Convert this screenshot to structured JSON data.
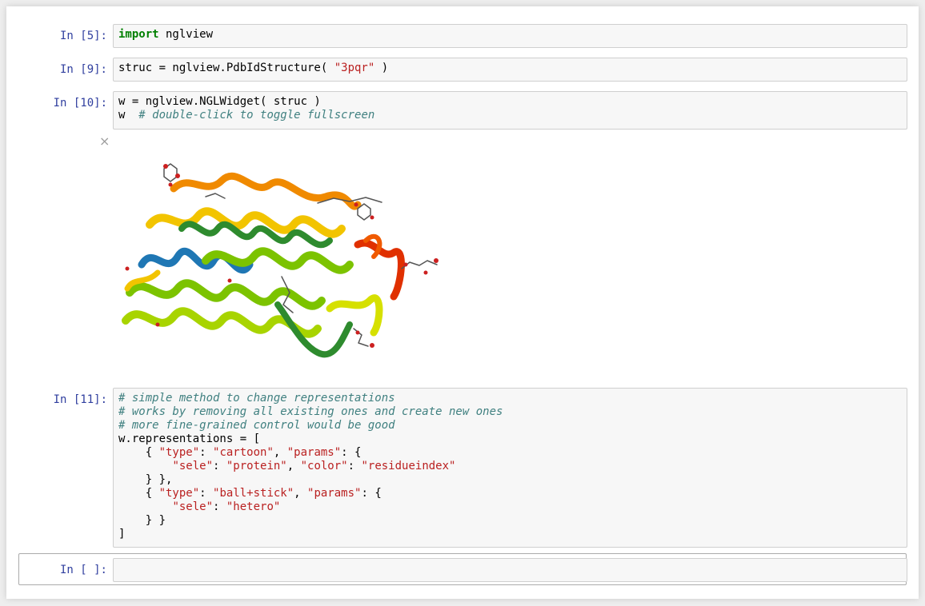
{
  "cells": [
    {
      "prompt": "In [5]:",
      "lines": [
        [
          [
            "kw",
            "import"
          ],
          [
            "t",
            " nglview"
          ]
        ]
      ]
    },
    {
      "prompt": "In [9]:",
      "lines": [
        [
          [
            "t",
            "struc = nglview.PdbIdStructure( "
          ],
          [
            "str",
            "\"3pqr\""
          ],
          [
            "t",
            " )"
          ]
        ]
      ]
    },
    {
      "prompt": "In [10]:",
      "lines": [
        [
          [
            "t",
            "w = nglview.NGLWidget( struc )"
          ]
        ],
        [
          [
            "t",
            "w  "
          ],
          [
            "cm",
            "# double-click to toggle fullscreen"
          ]
        ]
      ]
    },
    {
      "prompt": "In [11]:",
      "lines": [
        [
          [
            "cm",
            "# simple method to change representations"
          ]
        ],
        [
          [
            "cm",
            "# works by removing all existing ones and create new ones"
          ]
        ],
        [
          [
            "cm",
            "# more fine-grained control would be good"
          ]
        ],
        [
          [
            "t",
            "w.representations = ["
          ]
        ],
        [
          [
            "t",
            "    { "
          ],
          [
            "str",
            "\"type\""
          ],
          [
            "t",
            ": "
          ],
          [
            "str",
            "\"cartoon\""
          ],
          [
            "t",
            ", "
          ],
          [
            "str",
            "\"params\""
          ],
          [
            "t",
            ": {"
          ]
        ],
        [
          [
            "t",
            "        "
          ],
          [
            "str",
            "\"sele\""
          ],
          [
            "t",
            ": "
          ],
          [
            "str",
            "\"protein\""
          ],
          [
            "t",
            ", "
          ],
          [
            "str",
            "\"color\""
          ],
          [
            "t",
            ": "
          ],
          [
            "str",
            "\"residueindex\""
          ]
        ],
        [
          [
            "t",
            "    } },"
          ]
        ],
        [
          [
            "t",
            "    { "
          ],
          [
            "str",
            "\"type\""
          ],
          [
            "t",
            ": "
          ],
          [
            "str",
            "\"ball+stick\""
          ],
          [
            "t",
            ", "
          ],
          [
            "str",
            "\"params\""
          ],
          [
            "t",
            ": {"
          ]
        ],
        [
          [
            "t",
            "        "
          ],
          [
            "str",
            "\"sele\""
          ],
          [
            "t",
            ": "
          ],
          [
            "str",
            "\"hetero\""
          ]
        ],
        [
          [
            "t",
            "    } }"
          ]
        ],
        [
          [
            "t",
            "]"
          ]
        ]
      ]
    },
    {
      "prompt": "In [ ]:",
      "lines": []
    }
  ],
  "widget": {
    "close_icon": "×",
    "viewer_icon": "protein-ribbon-structure",
    "ribbon_colors": [
      "#1f77b4",
      "#1aa3a3",
      "#2e8b2e",
      "#7cc300",
      "#d6e000",
      "#f2c400",
      "#f08a00",
      "#e03000"
    ]
  }
}
